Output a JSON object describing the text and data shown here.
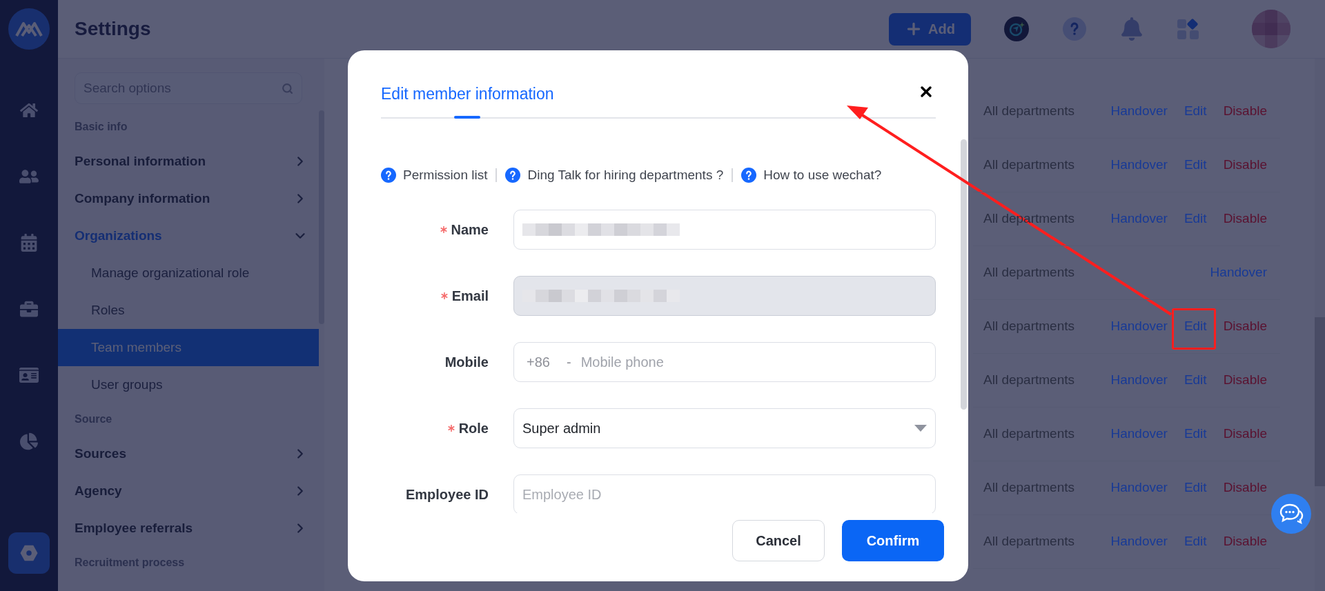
{
  "rail": [
    {
      "selected": false
    },
    {
      "selected": false
    },
    {
      "selected": false
    },
    {
      "selected": false
    },
    {
      "selected": false
    },
    {
      "selected": false
    },
    {
      "selected": true
    }
  ],
  "header": {
    "title": "Settings",
    "add_button": "Add"
  },
  "sidebar": {
    "search": {
      "placeholder": "Search options"
    },
    "sections": [
      {
        "heading": "Basic info",
        "items": [
          {
            "label": "Personal information",
            "selected": false,
            "expanded": false
          },
          {
            "label": "Company information",
            "selected": false,
            "expanded": false
          },
          {
            "label": "Organizations",
            "selected": false,
            "expanded": true,
            "children": [
              {
                "label": "Manage organizational role",
                "selected": false
              },
              {
                "label": "Roles",
                "selected": false
              },
              {
                "label": "Team members",
                "selected": true
              },
              {
                "label": "User groups",
                "selected": false
              }
            ]
          }
        ]
      },
      {
        "heading": "Source",
        "items": [
          {
            "label": "Sources",
            "selected": false,
            "expanded": false
          },
          {
            "label": "Agency",
            "selected": false,
            "expanded": false
          },
          {
            "label": "Employee referrals",
            "selected": false,
            "expanded": false
          }
        ]
      },
      {
        "heading": "Recruitment process"
      }
    ]
  },
  "table": {
    "rows": [
      {
        "department": "All departments",
        "actions": [
          {
            "label": "Handover",
            "kind": "link"
          },
          {
            "label": "Edit",
            "kind": "link"
          },
          {
            "label": "Disable",
            "kind": "danger"
          }
        ]
      },
      {
        "department": "All departments",
        "actions": [
          {
            "label": "Handover",
            "kind": "link"
          },
          {
            "label": "Edit",
            "kind": "link"
          },
          {
            "label": "Disable",
            "kind": "danger"
          }
        ]
      },
      {
        "department": "All departments",
        "actions": [
          {
            "label": "Handover",
            "kind": "link"
          },
          {
            "label": "Edit",
            "kind": "link"
          },
          {
            "label": "Disable",
            "kind": "danger"
          }
        ]
      },
      {
        "department": "All departments",
        "actions": [
          {
            "label": "Handover",
            "kind": "link"
          }
        ]
      },
      {
        "department": "All departments",
        "actions": [
          {
            "label": "Handover",
            "kind": "link"
          },
          {
            "label": "Edit",
            "kind": "link"
          },
          {
            "label": "Disable",
            "kind": "danger"
          }
        ]
      },
      {
        "department": "All departments",
        "actions": [
          {
            "label": "Handover",
            "kind": "link"
          },
          {
            "label": "Edit",
            "kind": "link"
          },
          {
            "label": "Disable",
            "kind": "danger"
          }
        ]
      },
      {
        "department": "All departments",
        "actions": [
          {
            "label": "Handover",
            "kind": "link"
          },
          {
            "label": "Edit",
            "kind": "link"
          },
          {
            "label": "Disable",
            "kind": "danger"
          }
        ]
      },
      {
        "department": "All departments",
        "actions": [
          {
            "label": "Handover",
            "kind": "link"
          },
          {
            "label": "Edit",
            "kind": "link"
          },
          {
            "label": "Disable",
            "kind": "danger"
          }
        ]
      },
      {
        "department": "All departments",
        "actions": [
          {
            "label": "Handover",
            "kind": "link"
          },
          {
            "label": "Edit",
            "kind": "link"
          },
          {
            "label": "Disable",
            "kind": "danger"
          }
        ]
      }
    ]
  },
  "modal": {
    "tabs": [
      {
        "label": "Edit member information",
        "selected": true
      }
    ],
    "help_links": [
      "Permission list",
      "Ding Talk for hiring departments ?",
      "How to use wechat?"
    ],
    "fields": [
      {
        "label": "Name",
        "required": true,
        "kind": "text",
        "disabled": false,
        "obscured": true
      },
      {
        "label": "Email",
        "required": true,
        "kind": "text",
        "disabled": true,
        "obscured": true
      },
      {
        "label": "Mobile",
        "required": false,
        "kind": "phone",
        "disabled": false,
        "prefix": "+86",
        "separator": "-",
        "placeholder": "Mobile phone"
      },
      {
        "label": "Role",
        "required": true,
        "kind": "select",
        "disabled": false,
        "value": "Super admin"
      },
      {
        "label": "Employee ID",
        "required": false,
        "kind": "text",
        "disabled": false,
        "placeholder": "Employee ID"
      }
    ],
    "buttons": [
      {
        "label": "Cancel",
        "kind": "secondary"
      },
      {
        "label": "Confirm",
        "kind": "primary"
      }
    ]
  }
}
